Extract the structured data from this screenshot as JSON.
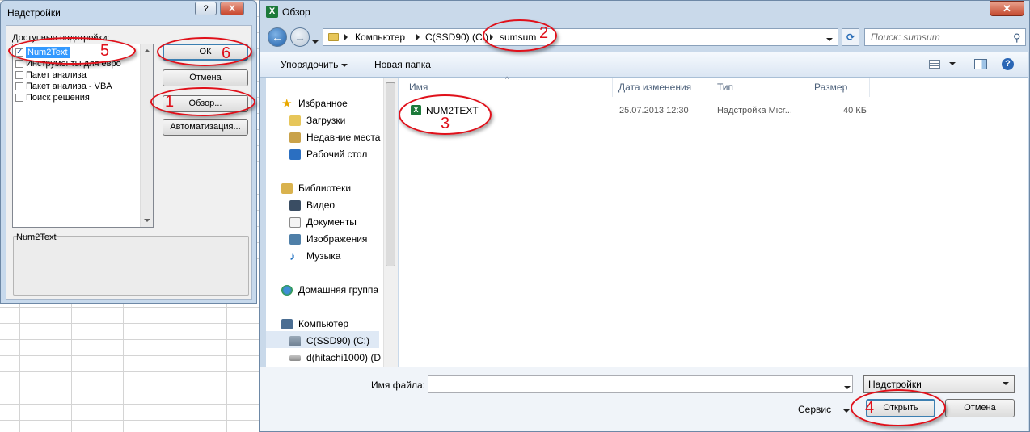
{
  "addins_dialog": {
    "title": "Надстройки",
    "help_label": "?",
    "close_label": "X",
    "available_label": "Доступные надстройки:",
    "items": [
      {
        "label": "Num2Text",
        "checked": true,
        "selected": true
      },
      {
        "label": "Инструменты для евро",
        "checked": false,
        "selected": false
      },
      {
        "label": "Пакет анализа",
        "checked": false,
        "selected": false
      },
      {
        "label": "Пакет анализа - VBA",
        "checked": false,
        "selected": false
      },
      {
        "label": "Поиск решения",
        "checked": false,
        "selected": false
      }
    ],
    "ok_label": "ОК",
    "cancel_label": "Отмена",
    "browse_label": "Обзор...",
    "automation_label": "Автоматизация...",
    "description": "Num2Text"
  },
  "open_dialog": {
    "title": "Обзор",
    "app_icon": "X",
    "close_label": "✕",
    "back_icon": "←",
    "forward_icon": "→",
    "breadcrumb": [
      "Компьютер",
      "C(SSD90) (C:)",
      "sumsum"
    ],
    "search_placeholder": "Поиск: sumsum",
    "toolbar": {
      "organize_label": "Упорядочить",
      "new_folder_label": "Новая папка"
    },
    "nav": {
      "favorites": "Избранное",
      "downloads": "Загрузки",
      "recent": "Недавние места",
      "desktop": "Рабочий стол",
      "libraries": "Библиотеки",
      "video": "Видео",
      "documents": "Документы",
      "images": "Изображения",
      "music": "Музыка",
      "homegroup": "Домашняя группа",
      "computer": "Компьютер",
      "drive_c": "C(SSD90) (C:)",
      "drive_d": "d(hitachi1000) (D"
    },
    "columns": {
      "name": "Имя",
      "date": "Дата изменения",
      "type": "Тип",
      "size": "Размер"
    },
    "file": {
      "name": "NUM2TEXT",
      "date": "25.07.2013 12:30",
      "type": "Надстройка Micr...",
      "size": "40 КБ"
    },
    "filename_label": "Имя файла:",
    "filename_value": "",
    "filetype_value": "Надстройки",
    "service_label": "Сервис",
    "open_label": "Открыть",
    "cancel_label": "Отмена"
  },
  "annotations": [
    "1",
    "2",
    "3",
    "4",
    "5",
    "6"
  ],
  "colors": {
    "annotation": "#e0101a",
    "selection": "#3399ff"
  }
}
